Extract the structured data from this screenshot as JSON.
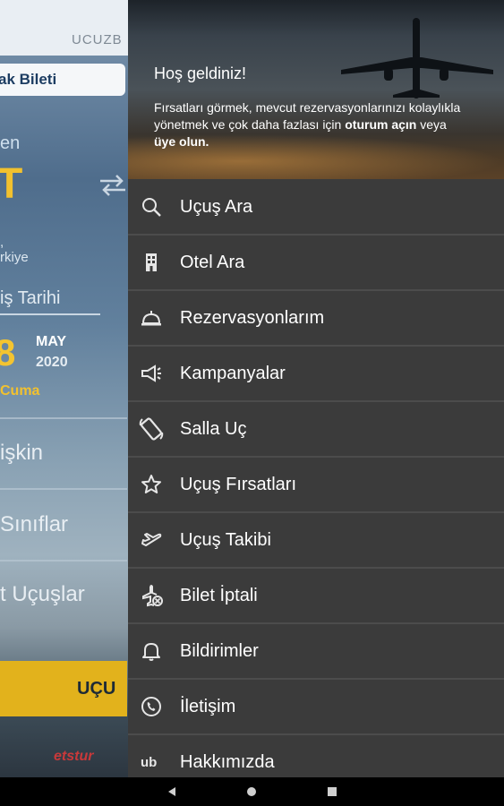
{
  "background": {
    "logo_text": "UCUZB",
    "tab_label": "ak Bileti",
    "from_label": "en",
    "from_code": "T",
    "from_country_line1": ",",
    "from_country_line2": "rkiye",
    "date_label": "iş Tarihi",
    "date_day": "8",
    "date_month": "MAY",
    "date_year": "2020",
    "date_weekday": "Cuma",
    "rows": [
      "işkin",
      "Sınıflar",
      "t Uçuşlar"
    ],
    "search_button": "UÇU",
    "brand_text": "etstur"
  },
  "drawer": {
    "welcome": "Hoş geldiniz!",
    "desc_part1": "Fırsatları görmek, mevcut rezervasyonlarınızı kolaylıkla yönetmek ve çok daha fazlası için",
    "desc_link1": "oturum açın",
    "desc_part2": "veya",
    "desc_link2": "üye olun.",
    "menu": [
      {
        "label": "Uçuş Ara",
        "icon": "search-icon"
      },
      {
        "label": "Otel Ara",
        "icon": "hotel-icon"
      },
      {
        "label": "Rezervasyonlarım",
        "icon": "bell-cloche-icon"
      },
      {
        "label": "Kampanyalar",
        "icon": "megaphone-icon"
      },
      {
        "label": "Salla Uç",
        "icon": "phone-shake-icon"
      },
      {
        "label": "Uçuş Fırsatları",
        "icon": "star-icon"
      },
      {
        "label": "Uçuş Takibi",
        "icon": "plane-takeoff-icon"
      },
      {
        "label": "Bilet İptali",
        "icon": "plane-cancel-icon"
      },
      {
        "label": "Bildirimler",
        "icon": "notification-bell-icon"
      },
      {
        "label": "İletişim",
        "icon": "phone-icon"
      },
      {
        "label": "Hakkımızda",
        "icon": "ub-logo-icon"
      }
    ]
  },
  "colors": {
    "drawer_bg": "#3b3b3b",
    "accent_yellow": "#f2c12e",
    "navbar_bg": "#000000"
  }
}
